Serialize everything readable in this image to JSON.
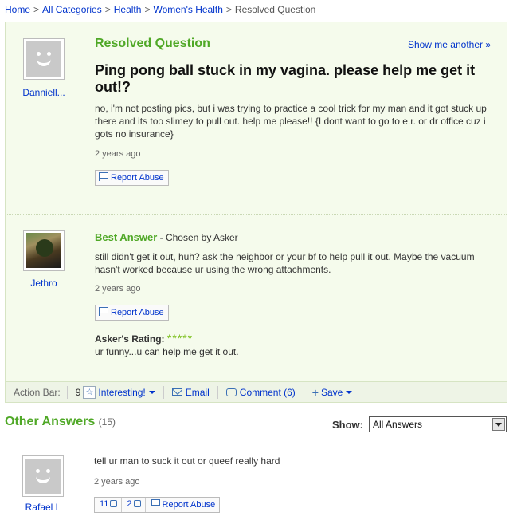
{
  "breadcrumb": {
    "home": "Home",
    "all_categories": "All Categories",
    "health": "Health",
    "womens_health": "Women's Health",
    "current": "Resolved Question",
    "separator": ">"
  },
  "question": {
    "status": "Resolved Question",
    "show_another": "Show me another »",
    "asker": "Danniell...",
    "subject": "Ping pong ball stuck in my vagina. please help me get it out!?",
    "body": "no, i'm not posting pics, but i was trying to practice a cool trick for my man and it got stuck up there and its too slimey to pull out. help me please!! {I dont want to go to e.r. or dr office cuz i gots no insurance}",
    "time": "2 years ago",
    "report_abuse": "Report Abuse"
  },
  "best_answer": {
    "label": "Best Answer",
    "chosen": " - Chosen by Asker",
    "answerer": "Jethro",
    "body": "still didn't get it out, huh? ask the neighbor or your bf to help pull it out. Maybe the vacuum hasn't worked because ur using the wrong attachments.",
    "time": "2 years ago",
    "report_abuse": "Report Abuse",
    "rating_label": "Asker's Rating:",
    "rating_stars": "*****",
    "rating_value": 5,
    "rating_comment": "ur funny...u can help me get it out."
  },
  "action_bar": {
    "label": "Action Bar:",
    "interesting_count": "9",
    "interesting": "Interesting!",
    "email": "Email",
    "comment": "Comment (6)",
    "save": "Save"
  },
  "other_answers": {
    "title": "Other Answers",
    "count": "(15)",
    "show_label": "Show:",
    "show_value": "All Answers",
    "answers": [
      {
        "answerer": "Rafael L",
        "body": "tell ur man to suck it out or queef really hard",
        "time": "2 years ago",
        "thumbs_up": "11",
        "thumbs_down": "2",
        "report_abuse": "Report Abuse"
      }
    ]
  },
  "colors": {
    "accent_green": "#4fa826",
    "link_blue": "#0033cc",
    "panel_bg": "#f5fbec"
  }
}
